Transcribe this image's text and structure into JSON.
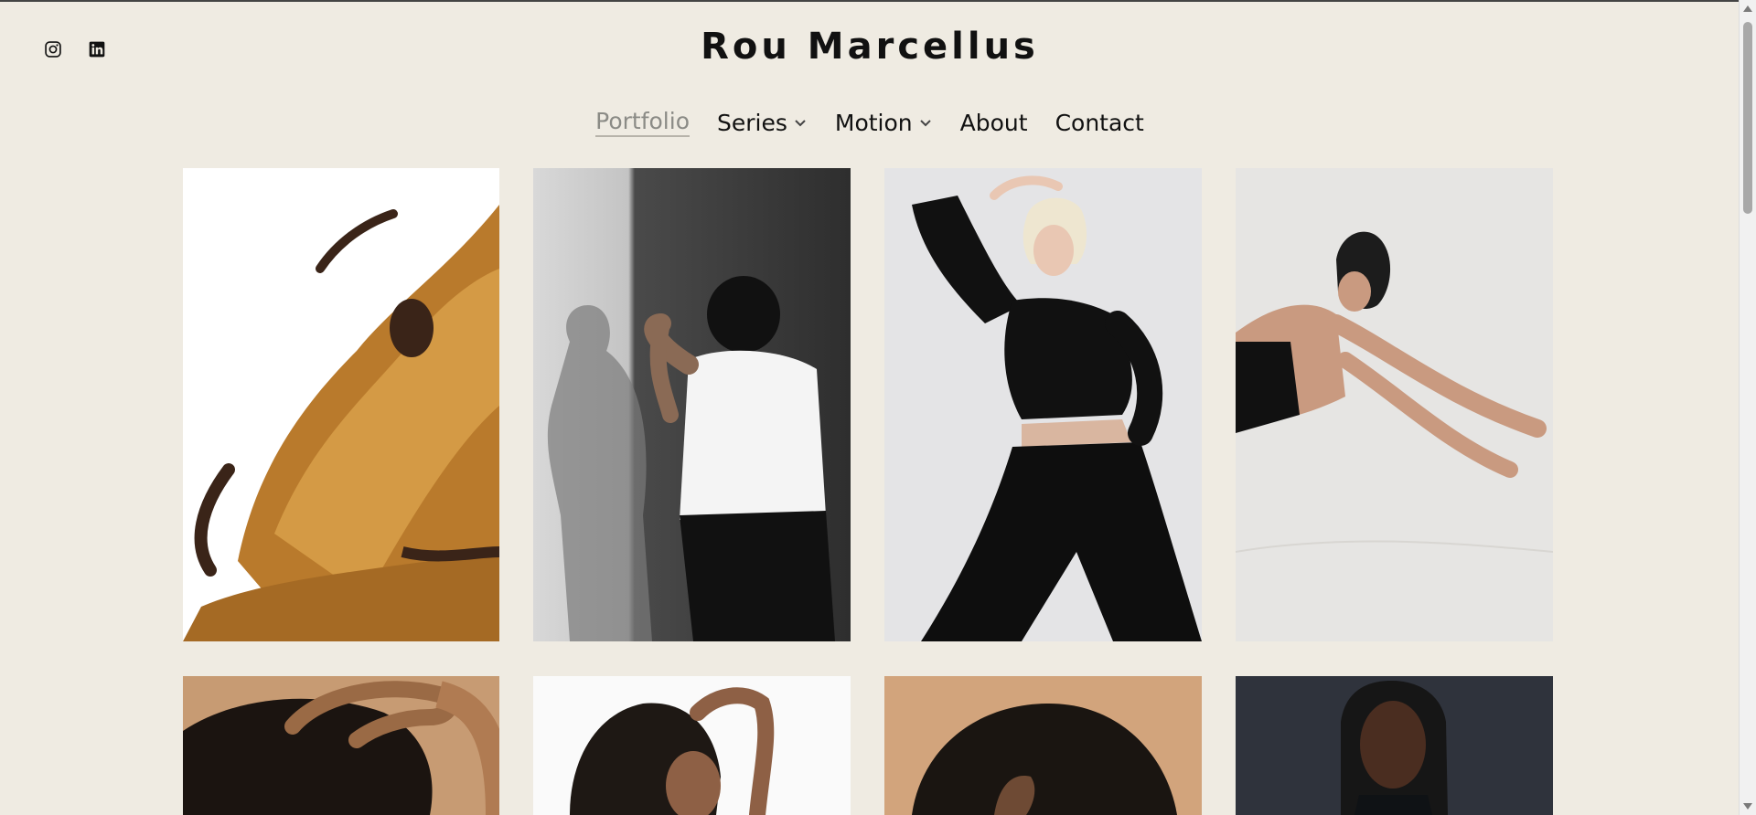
{
  "site": {
    "title": "Rou Marcellus"
  },
  "social": [
    {
      "name": "instagram-icon"
    },
    {
      "name": "linkedin-icon"
    }
  ],
  "nav": {
    "items": [
      {
        "label": "Portfolio",
        "active": true,
        "dropdown": false
      },
      {
        "label": "Series",
        "active": false,
        "dropdown": true
      },
      {
        "label": "Motion",
        "active": false,
        "dropdown": true
      },
      {
        "label": "About",
        "active": false,
        "dropdown": false
      },
      {
        "label": "Contact",
        "active": false,
        "dropdown": false
      }
    ]
  },
  "gallery": {
    "items": [
      {
        "name": "photo-gold-fabric-dancer"
      },
      {
        "name": "photo-white-tank-shadow"
      },
      {
        "name": "photo-blonde-black-suit"
      },
      {
        "name": "photo-reclining-pose"
      },
      {
        "name": "photo-hand-on-curly-hair"
      },
      {
        "name": "photo-curly-hair-portrait"
      },
      {
        "name": "photo-head-top-closeup"
      },
      {
        "name": "photo-braids-portrait"
      }
    ]
  },
  "colors": {
    "background": "#efebe2",
    "nav_active": "#8b8b86",
    "text": "#111111"
  }
}
